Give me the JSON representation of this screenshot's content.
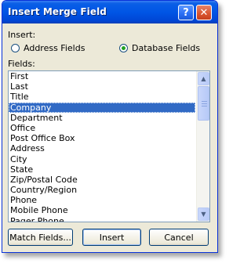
{
  "window": {
    "title": "Insert Merge Field",
    "help_label": "?",
    "close_label": "✕"
  },
  "insert": {
    "label": "Insert:",
    "options": [
      {
        "label": "Address Fields",
        "selected": false
      },
      {
        "label": "Database Fields",
        "selected": true
      }
    ]
  },
  "fields": {
    "label": "Fields:",
    "selected": "Company",
    "items": [
      "First",
      "Last",
      "Title",
      "Company",
      "Department",
      "Office",
      "Post Office Box",
      "Address",
      "City",
      "State",
      "Zip/Postal Code",
      "Country/Region",
      "Phone",
      "Mobile Phone",
      "Pager Phone"
    ]
  },
  "scrollbar": {
    "up_icon": "▲",
    "down_icon": "▼"
  },
  "buttons": {
    "match_fields": "Match Fields...",
    "insert": "Insert",
    "cancel": "Cancel"
  },
  "colors": {
    "title_bar": "#0055e5",
    "selection": "#316ac5",
    "dialog_face": "#ece9d8"
  }
}
